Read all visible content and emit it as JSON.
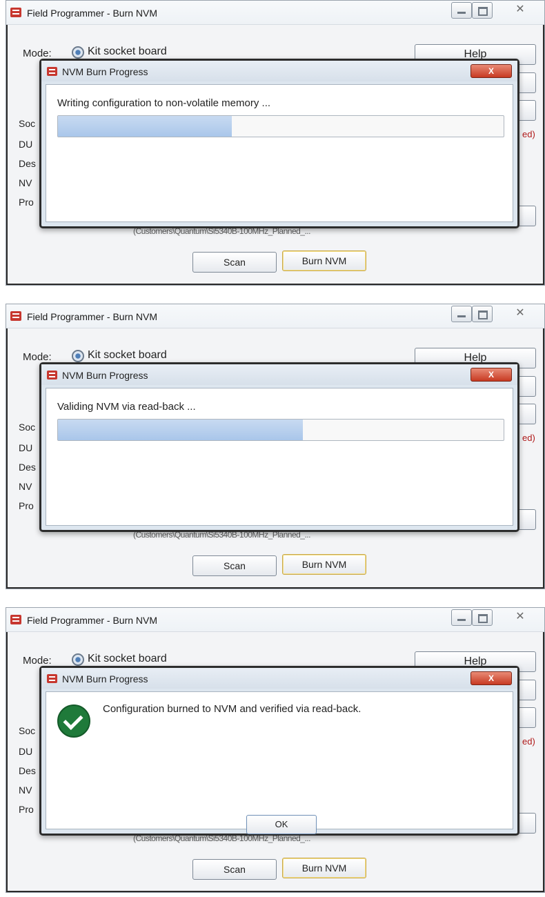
{
  "window": {
    "title": "Field Programmer - Burn NVM",
    "close_glyph": "✕",
    "mode_label": "Mode:",
    "mode_value": "Kit socket board",
    "help_label": "Help",
    "partial_status": "ed)",
    "left_labels": [
      "Soc",
      "DU",
      "Des",
      "NV",
      "Pro"
    ],
    "path_text": "(Customers\\Quantum\\Si5340B-100MHz_Planned_...",
    "scan_label": "Scan",
    "burn_label": "Burn NVM"
  },
  "dialog": {
    "title": "NVM Burn Progress",
    "close_glyph": "X"
  },
  "steps": [
    {
      "message": "Writing configuration to non-volatile memory ...",
      "progress": 0.39
    },
    {
      "message": "Validing NVM via read-back ...",
      "progress": 0.55
    },
    {
      "message": "Configuration burned to NVM and verified via read-back.",
      "ok_label": "OK"
    }
  ],
  "colors": {
    "progress_fill": "#a9c6ea",
    "success_icon": "#1f7a3a",
    "close_button": "#c73a22",
    "status_red": "#b01919"
  }
}
